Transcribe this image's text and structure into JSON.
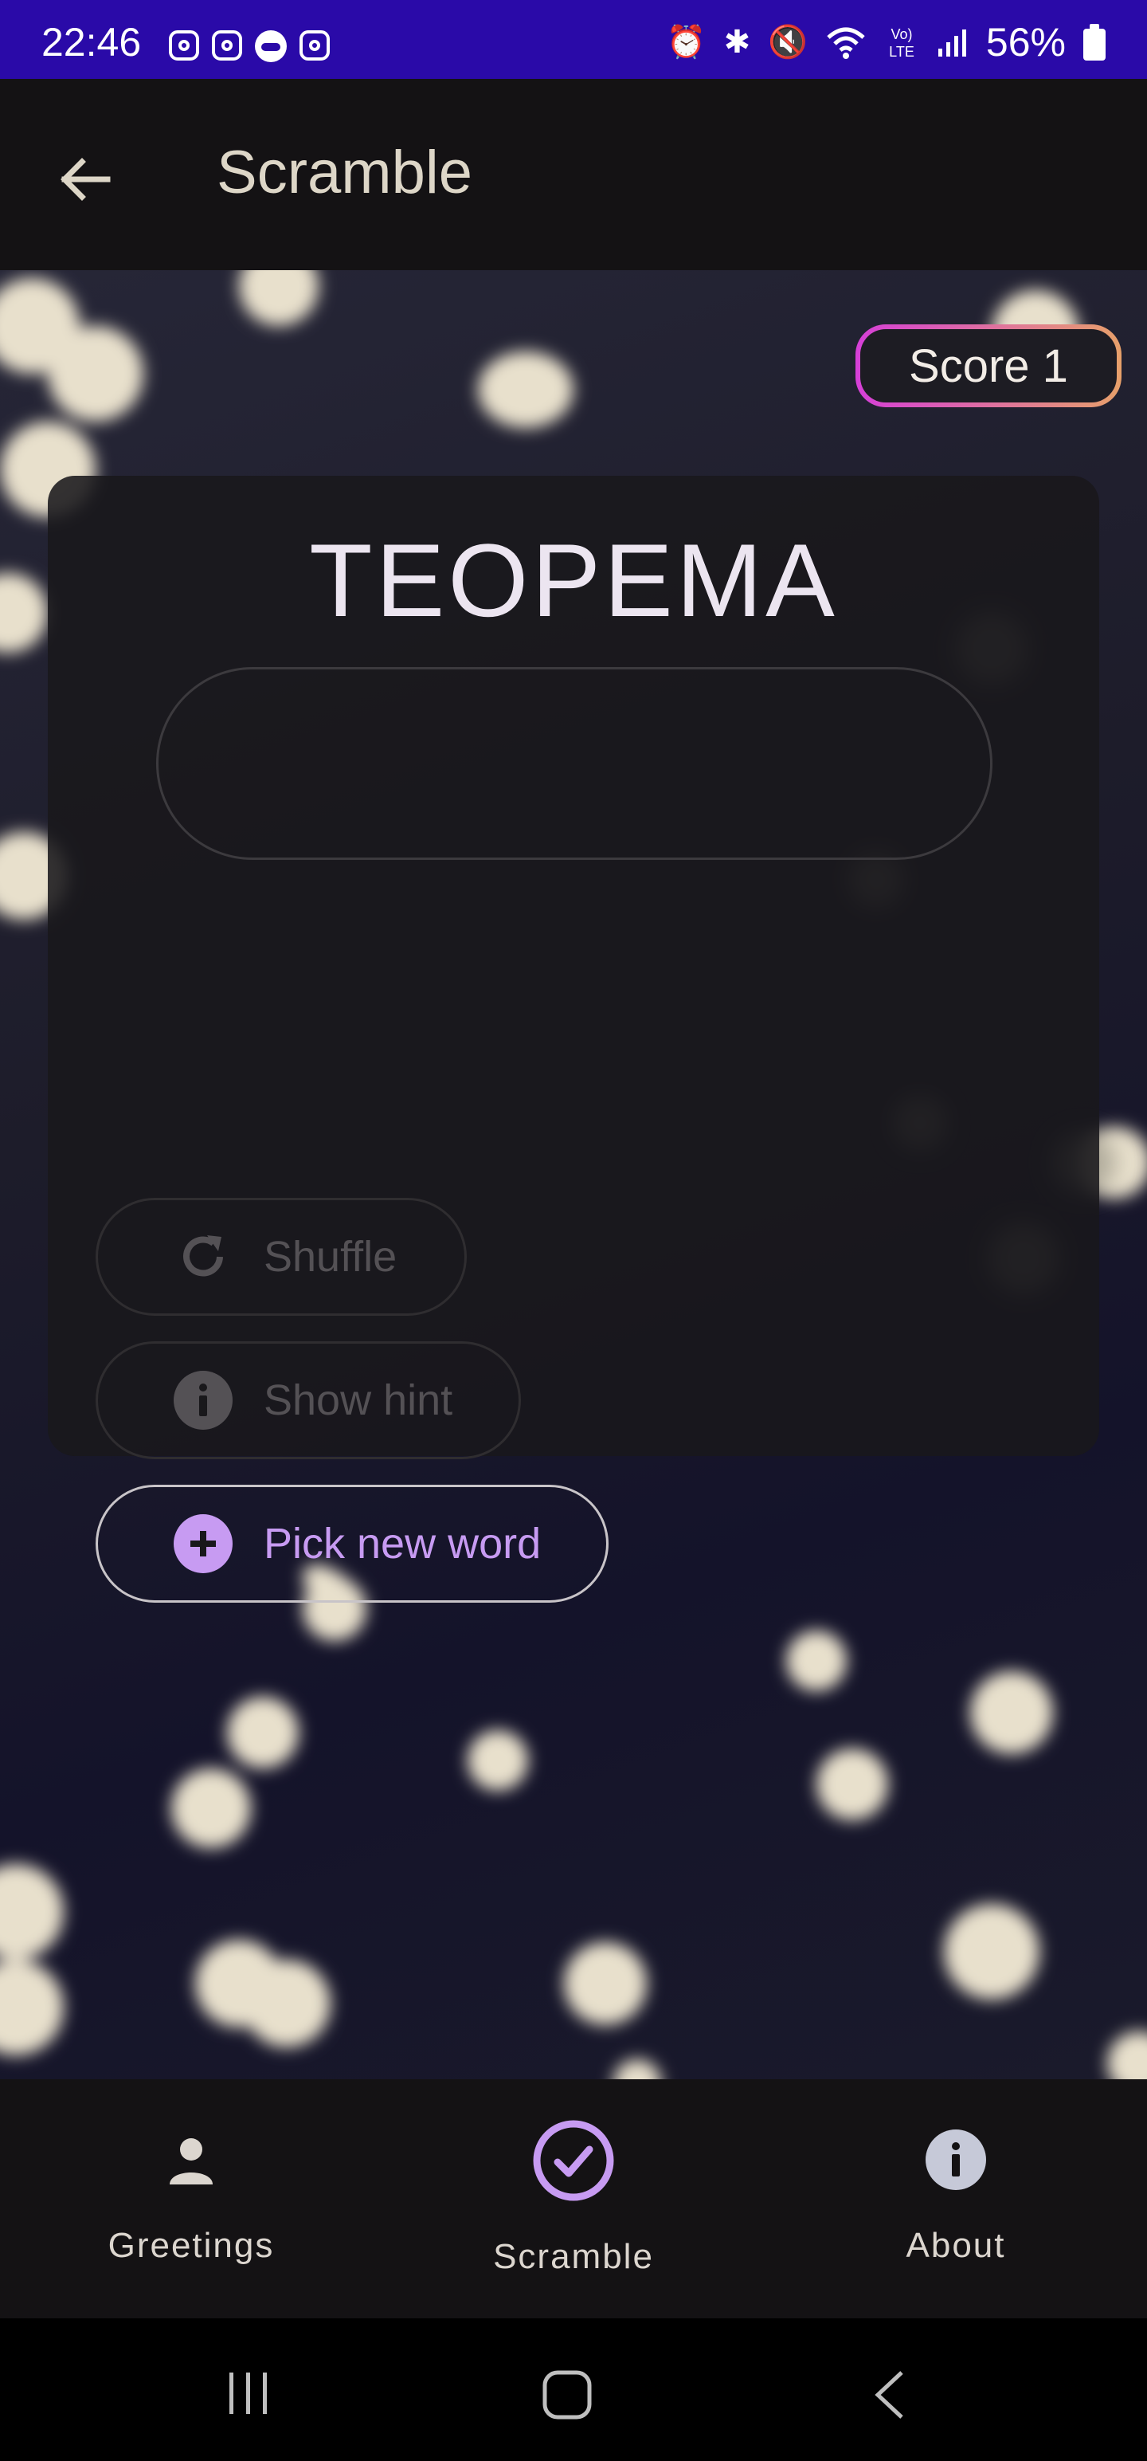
{
  "status_bar": {
    "time": "22:46",
    "left_icons": [
      "instagram-icon",
      "instagram-icon",
      "robot-icon",
      "instagram-icon"
    ],
    "right_icons": [
      "alarm-icon",
      "bluetooth-icon",
      "mute-icon",
      "wifi-icon",
      "volte-icon",
      "signal-icon"
    ],
    "battery": "56%",
    "background": "#2a0aa8"
  },
  "app_bar": {
    "title": "Scramble",
    "back_icon": "arrow-back-icon"
  },
  "score": {
    "label": "Score 1"
  },
  "game": {
    "scrambled_word": "TEOPEMA",
    "answer_value": "",
    "answer_placeholder": "",
    "buttons": {
      "shuffle": "Shuffle",
      "hint": "Show hint",
      "new_word": "Pick new word"
    },
    "accent": "#c79bf2"
  },
  "bottom_nav": {
    "items": [
      {
        "label": "Greetings",
        "icon": "person-icon",
        "selected": false
      },
      {
        "label": "Scramble",
        "icon": "check-circle-icon",
        "selected": true
      },
      {
        "label": "About",
        "icon": "info-icon",
        "selected": false
      }
    ]
  },
  "system_nav": {
    "icons": [
      "recents-icon",
      "home-icon",
      "back-icon"
    ]
  }
}
